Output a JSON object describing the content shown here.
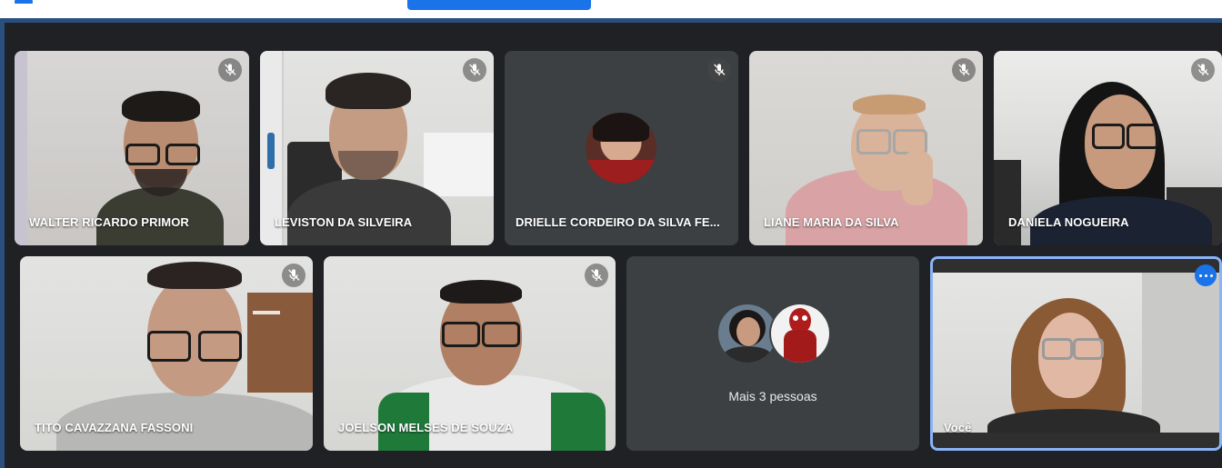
{
  "participants": [
    {
      "name": "WALTER RICARDO PRIMOR",
      "muted": true,
      "has_video": true
    },
    {
      "name": "LEVISTON DA SILVEIRA",
      "muted": true,
      "has_video": true
    },
    {
      "name": "DRIELLE CORDEIRO DA SILVA FE...",
      "muted": true,
      "has_video": false
    },
    {
      "name": "LIANE MARIA DA SILVA",
      "muted": true,
      "has_video": true
    },
    {
      "name": "DANIELA NOGUEIRA",
      "muted": true,
      "has_video": true
    },
    {
      "name": "TITO CAVAZZANA FASSONI",
      "muted": true,
      "has_video": true
    },
    {
      "name": "JOELSON MELSES DE SOUZA",
      "muted": true,
      "has_video": true
    }
  ],
  "overflow": {
    "label": "Mais 3 pessoas"
  },
  "self": {
    "name": "Você"
  },
  "colors": {
    "stage_background": "#202124",
    "tile_background": "#3c4043",
    "accent_blue": "#1a73e8",
    "self_highlight": "#8ab4f8"
  },
  "icons": {
    "muted": "mic-off-icon",
    "more": "more-options-icon"
  }
}
